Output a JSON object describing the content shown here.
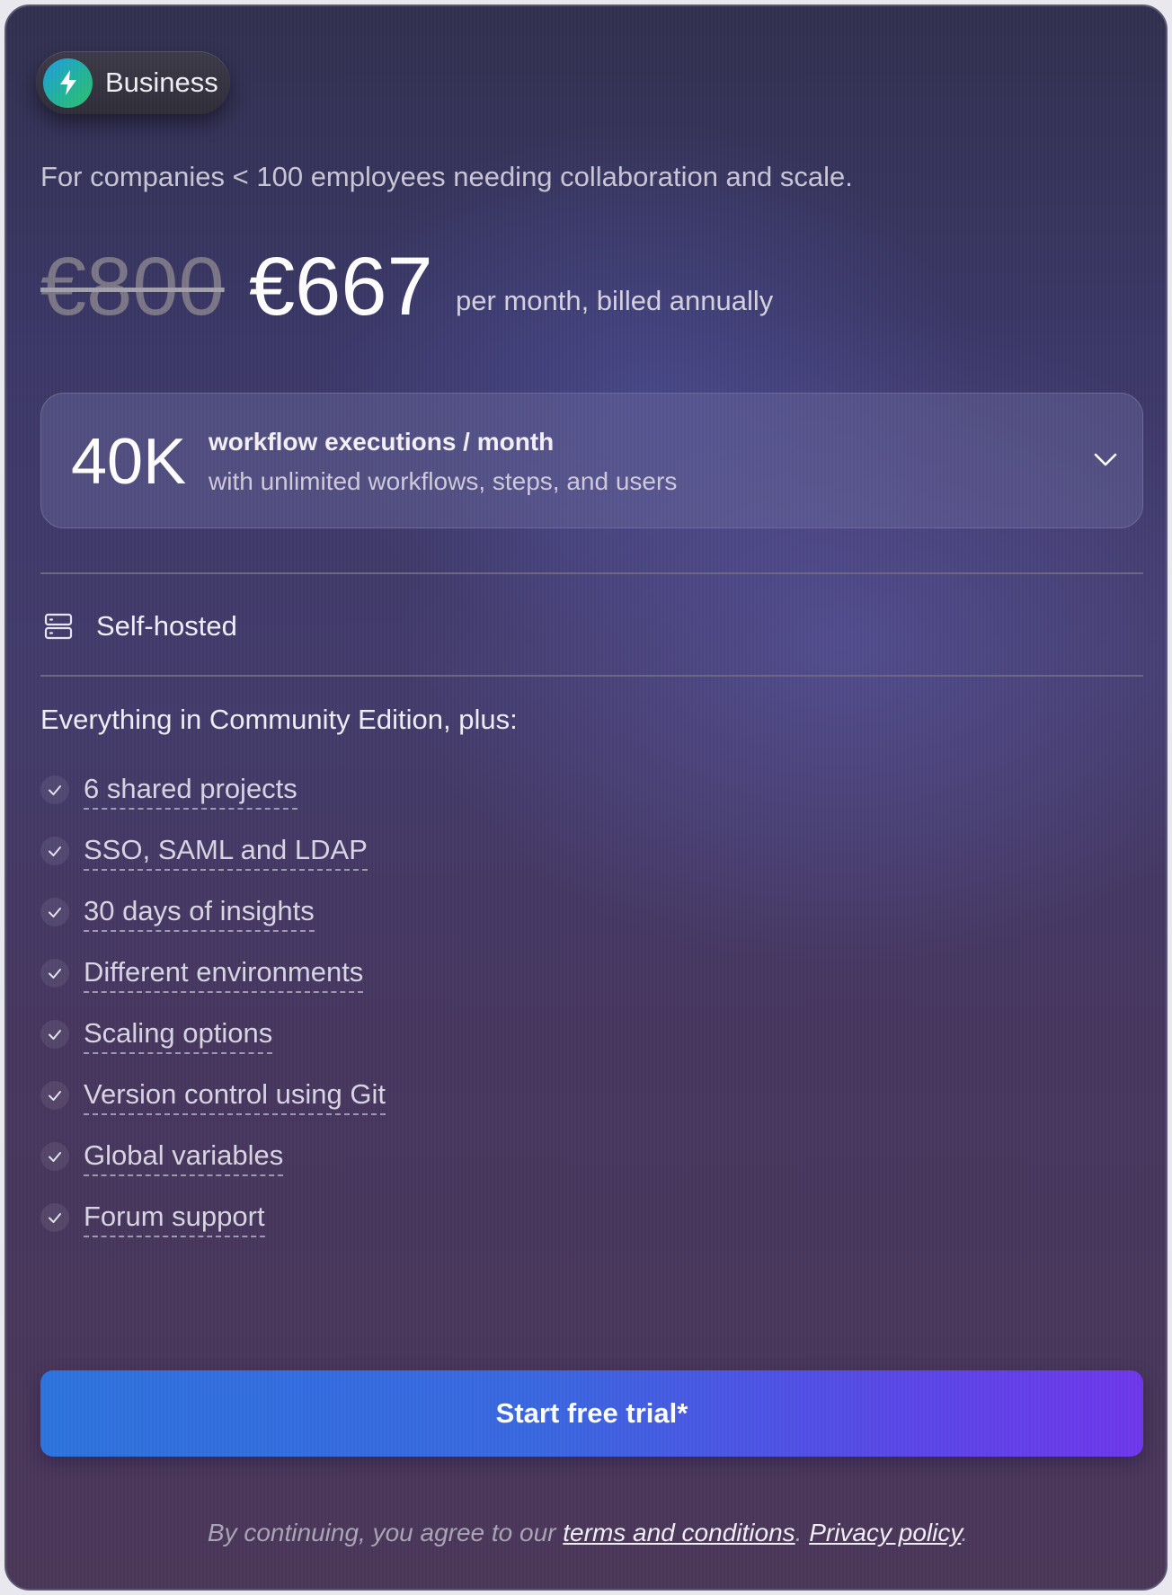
{
  "plan": {
    "name": "Business",
    "icon": "lightning-icon",
    "description": "For companies < 100 employees needing collaboration and scale."
  },
  "pricing": {
    "original_price": "€800",
    "price": "€667",
    "billing_note": "per month, billed annually"
  },
  "executions": {
    "amount": "40K",
    "title": "workflow executions / month",
    "subtitle": "with unlimited workflows, steps, and users",
    "icon": "chevron-down-icon"
  },
  "hosting": {
    "label": "Self-hosted",
    "icon": "server-icon"
  },
  "features": {
    "heading": "Everything in Community Edition, plus:",
    "items": [
      "6 shared projects",
      "SSO, SAML and LDAP",
      "30 days of insights",
      "Different environments",
      "Scaling options",
      "Version control using Git",
      "Global variables",
      "Forum support"
    ]
  },
  "cta": {
    "label": "Start free trial*"
  },
  "legal": {
    "prefix": "By continuing, you agree to our",
    "terms_label": "terms and conditions",
    "separator": ".",
    "privacy_label": "Privacy policy",
    "suffix": "."
  },
  "colors": {
    "cta_start": "#2d73de",
    "cta_end": "#6e37ec",
    "badge_icon_start": "#1f9be6",
    "badge_icon_end": "#2fbf6e"
  }
}
